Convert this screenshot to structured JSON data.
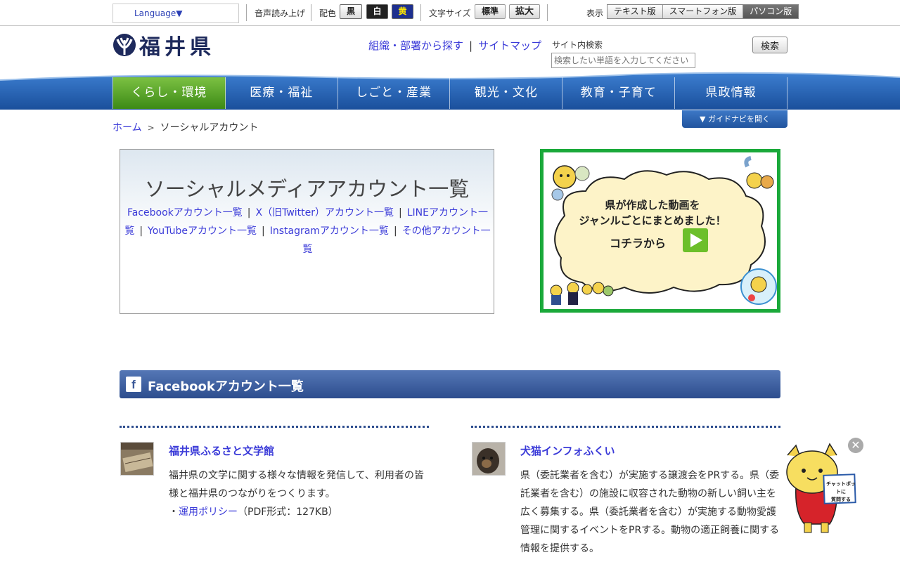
{
  "topbar": {
    "language": "Language▼",
    "voice": "音声読み上げ",
    "color_label": "配色",
    "color_black": "黒",
    "color_white": "白",
    "color_yellow": "黄",
    "fontsize_label": "文字サイズ",
    "fontsize_normal": "標準",
    "fontsize_large": "拡大",
    "view_label": "表示",
    "view_options": [
      "テキスト版",
      "スマートフォン版",
      "パソコン版"
    ]
  },
  "header": {
    "logo_text": "福井県",
    "link_org": "組織・部署から探す",
    "link_sep": "|",
    "link_sitemap": "サイトマップ",
    "search_label": "サイト内検索",
    "search_placeholder": "検索したい単語を入力してください",
    "search_button": "検索"
  },
  "nav": {
    "items": [
      "くらし・環境",
      "医療・福祉",
      "しごと・産業",
      "観光・文化",
      "教育・子育て",
      "県政情報"
    ]
  },
  "guide_button": "▼ ガイドナビを開く",
  "breadcrumb": {
    "home": "ホーム",
    "sep": ">",
    "current": "ソーシャルアカウント"
  },
  "title_box": {
    "title": "ソーシャルメディアアカウント一覧",
    "links": [
      "Facebookアカウント一覧",
      "X（旧Twitter）アカウント一覧",
      "LINEアカウント一覧",
      "YouTubeアカウント一覧",
      "Instagramアカウント一覧",
      "その他アカウント一覧"
    ],
    "sep": "|"
  },
  "banner": {
    "line1": "県が作成した動画を",
    "line2": "ジャンルごとにまとめました！",
    "cta": "コチラから"
  },
  "facebook_section": {
    "icon_letter": "f",
    "title": "Facebookアカウント一覧",
    "accounts": [
      {
        "name": "福井県ふるさと文学館",
        "description": "福井県の文学に関する様々な情報を発信して、利用者の皆様と福井県のつながりをつくります。",
        "policy_prefix": "・",
        "policy_link": "運用ポリシー",
        "policy_suffix": "（PDF形式：127KB）"
      },
      {
        "name": "犬猫インフォふくい",
        "description": "県（委託業者を含む）が実施する譲渡会をPRする。県（委託業者を含む）の施設に収容された動物の新しい飼い主を広く募集する。県（委託業者を含む）が実施する動物愛護管理に関するイベントをPRする。動物の適正飼養に関する情報を提供する。"
      }
    ]
  },
  "chatbot": {
    "close": "✕",
    "bubble_line1": "チャットボットに",
    "bubble_line2": "質問する"
  },
  "colors": {
    "nav_blue": "#1f5cae",
    "nav_active_green": "#5aa62c",
    "link_blue": "#3a3ad8",
    "facebook_header": "#3b5998",
    "banner_border": "#1aa93a"
  }
}
